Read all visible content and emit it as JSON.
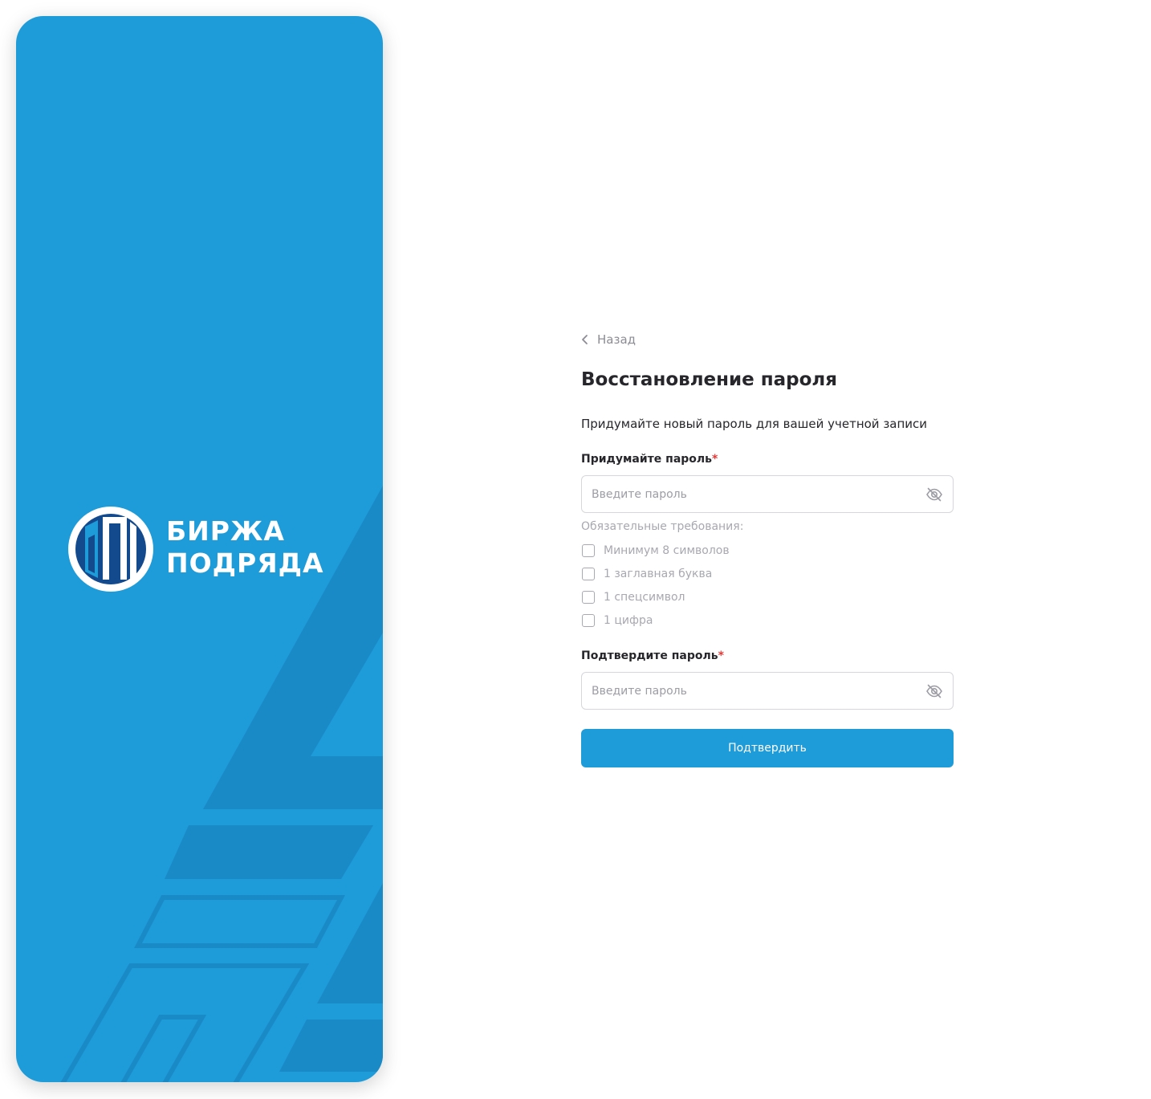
{
  "brand": {
    "line1": "БИРЖА",
    "line2": "ПОДРЯДА",
    "color": "#1e9bd9"
  },
  "form": {
    "back_label": "Назад",
    "title": "Восстановление пароля",
    "subtitle": "Придумайте новый пароль для вашей учетной записи",
    "password": {
      "label": "Придумайте пароль",
      "required_mark": "*",
      "placeholder": "Введите пароль",
      "value": "",
      "toggle_icon": "eye-off-icon"
    },
    "requirements": {
      "title": "Обязательные требования:",
      "items": [
        {
          "label": "Минимум 8 символов",
          "checked": false
        },
        {
          "label": "1 заглавная буква",
          "checked": false
        },
        {
          "label": "1 спецсимвол",
          "checked": false
        },
        {
          "label": "1 цифра",
          "checked": false
        }
      ]
    },
    "confirm": {
      "label": "Подтвердите пароль",
      "required_mark": "*",
      "placeholder": "Введите пароль",
      "value": "",
      "toggle_icon": "eye-off-icon"
    },
    "submit_label": "Подтвердить"
  },
  "colors": {
    "accent": "#1e9bd9",
    "required": "#e53935",
    "muted": "#a8a8b0",
    "text": "#26262b"
  }
}
